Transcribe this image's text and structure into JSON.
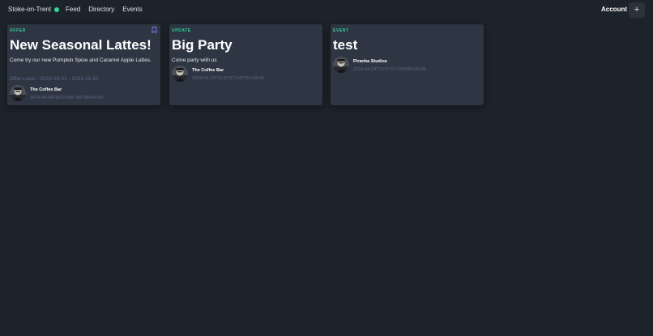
{
  "nav": {
    "brand": "Stoke-on-Trent",
    "links": [
      "Feed",
      "Directory",
      "Events"
    ],
    "account": "Account",
    "add_button": "+"
  },
  "cards": [
    {
      "type": "OFFER",
      "title": "New Seasonal Lattes!",
      "body": "Come try our new Pumpkin Spice and Caramel Apple Lattes.",
      "dates": "Offer Lasts - 2023-10-01 - 2023-11-30",
      "author": "The Coffee Bar",
      "timestamp": "2024-04-04T00:24:58.769798+00:00",
      "bookmark_icon": "bookmark-icon"
    },
    {
      "type": "UPDATE",
      "title": "Big Party",
      "body": "Come party with us",
      "author": "The Coffee Bar",
      "timestamp": "2024-04-29T13:32:57.547211+00:00"
    },
    {
      "type": "EVENT",
      "title": "test",
      "author": "Piranha Studios",
      "timestamp": "2024-04-29T13:27:57.035683+00:00"
    }
  ],
  "colors": {
    "background": "#1d232a",
    "card": "#2e3543",
    "accent_green": "#36d399",
    "bookmark": "#7b7ff0",
    "muted_text": "#5d6b86"
  }
}
